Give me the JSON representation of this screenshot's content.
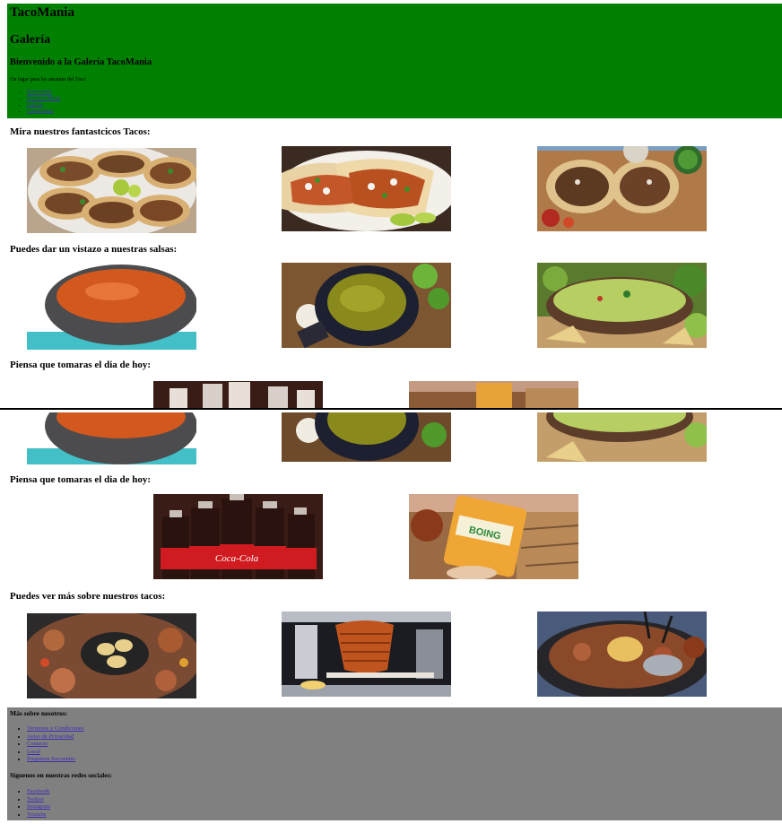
{
  "header": {
    "brand": "TacoMania",
    "page": "Galería",
    "welcome": "Bienvenido a la Galería TacoMania",
    "tagline": "Un lugar para los amantes del Taco",
    "nav": [
      "Bienvenido",
      "Nosotros/Menu",
      "Galería",
      "Contáctanos"
    ],
    "bg": "#008000"
  },
  "sections": {
    "tacos": "Mira nuestros fantastcicos Tacos:",
    "salsas": "Puedes dar un vistazo a nuestras salsas:",
    "drinks": "Piensa que tomaras el dia de hoy:",
    "more": "Puedes ver más sobre nuestros tacos:"
  },
  "images": {
    "tacos": [
      "tacos-plate-photo",
      "tacos-pastor-photo",
      "tacos-board-photo"
    ],
    "salsas": [
      "salsa-roja-molcajete-photo",
      "salsa-verde-molcajete-photo",
      "guacamole-photo"
    ],
    "drinks": [
      "coca-cola-bottles-photo",
      "boing-juice-photo"
    ],
    "more": [
      "comal-meats-photo",
      "trompo-pastor-photo",
      "cazo-carnitas-photo"
    ]
  },
  "drink_labels": {
    "coke": "Coca-Cola",
    "boing": "BOING"
  },
  "footer": {
    "about_heading": "Más sobre nosotros:",
    "about_links": [
      "Terminos y Condiciones",
      "Aviso de Privacidad",
      "Contacto",
      "Local",
      "Preguntas frecuentes"
    ],
    "social_heading": "Siguenos en nuestras redes sociales:",
    "social_links": [
      "Facebook",
      "Twitter",
      "Instagram",
      "Youtube"
    ],
    "bg": "#808080"
  }
}
